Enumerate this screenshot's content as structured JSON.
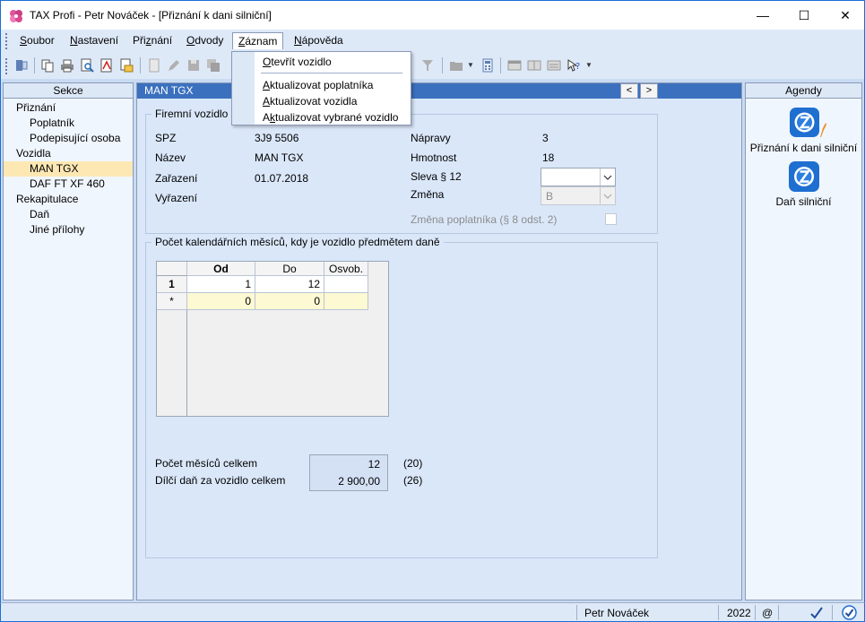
{
  "window": {
    "title": "TAX Profi - Petr Nováček - [Přiznání k dani silniční]",
    "minimize_glyph": "—",
    "maximize_glyph": "☐",
    "close_glyph": "✕"
  },
  "menubar": {
    "items": [
      {
        "pre": "",
        "key": "S",
        "post": "oubor"
      },
      {
        "pre": "",
        "key": "N",
        "post": "astavení"
      },
      {
        "pre": "Při",
        "key": "z",
        "post": "nání"
      },
      {
        "pre": "",
        "key": "O",
        "post": "dvody"
      },
      {
        "pre": "",
        "key": "Z",
        "post": "áznam"
      },
      {
        "pre": "",
        "key": "N",
        "post": "ápověda"
      }
    ]
  },
  "dropdown": {
    "items": [
      {
        "pre": "",
        "key": "O",
        "post": "tevřít vozidlo"
      },
      {
        "pre": "",
        "key": "A",
        "post": "ktualizovat poplatníka"
      },
      {
        "pre": "",
        "key": "A",
        "post": "ktualizovat vozidla"
      },
      {
        "pre": "A",
        "key": "k",
        "post": "tualizovat vybrané vozidlo"
      }
    ]
  },
  "sections": {
    "header": "Sekce",
    "tree": [
      {
        "label": "Přiznání",
        "level": 0
      },
      {
        "label": "Poplatník",
        "level": 1
      },
      {
        "label": "Podepisující osoba",
        "level": 1
      },
      {
        "label": "Vozidla",
        "level": 0
      },
      {
        "label": "MAN TGX",
        "level": 1,
        "selected": true
      },
      {
        "label": "DAF FT XF 460",
        "level": 1
      },
      {
        "label": "Rekapitulace",
        "level": 0
      },
      {
        "label": "Daň",
        "level": 1
      },
      {
        "label": "Jiné přílohy",
        "level": 1
      }
    ]
  },
  "document": {
    "header": "MAN TGX",
    "nav_prev": "<",
    "nav_next": ">",
    "vehicle_group": {
      "title": "Firemní vozidlo",
      "spz_label": "SPZ",
      "spz_value": "3J9 5506",
      "nazev_label": "Název",
      "nazev_value": "MAN TGX",
      "zarazeni_label": "Zařazení",
      "zarazeni_value": "01.07.2018",
      "vyrazeni_label": "Vyřazení",
      "napravy_label": "Nápravy",
      "napravy_value": "3",
      "hmotnost_label": "Hmotnost",
      "hmotnost_value": "18",
      "sleva_label": "Sleva § 12",
      "sleva_value": "",
      "zmena_label": "Změna",
      "zmena_value": "B",
      "zmena_poplatnika_label": "Změna poplatníka (§ 8 odst. 2)"
    },
    "months_group": {
      "title": "Počet kalendářních měsíců, kdy je vozidlo předmětem daně",
      "columns": [
        "Od",
        "Do",
        "Osvob."
      ],
      "rows": [
        {
          "index": "1",
          "od": "1",
          "do": "12",
          "osvob": ""
        }
      ],
      "new_row": {
        "index": "*",
        "od": "0",
        "do": "0",
        "osvob": ""
      }
    },
    "summary": {
      "months_label": "Počet měsíců celkem",
      "months_value": "12",
      "months_ref": "(20)",
      "tax_label": "Dílčí daň za vozidlo celkem",
      "tax_value": "2 900,00",
      "tax_ref": "(26)"
    }
  },
  "agendas": {
    "header": "Agendy",
    "items": [
      {
        "label": "Přiznání k dani silniční",
        "icon": "tax-return-edit-icon"
      },
      {
        "label": "Daň silniční",
        "icon": "road-tax-icon"
      }
    ]
  },
  "statusbar": {
    "user": "Petr Nováček",
    "year": "2022",
    "at": "@"
  },
  "colors": {
    "accent": "#3b70be",
    "selected": "#fde8b4",
    "new_row": "#fdf9d2"
  }
}
